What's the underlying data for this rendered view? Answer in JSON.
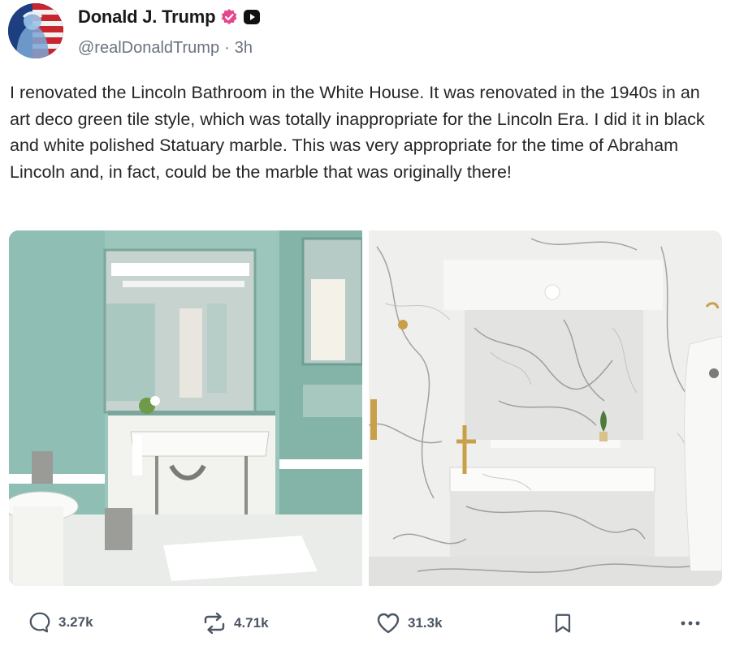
{
  "post": {
    "author_name": "Donald J. Trump",
    "handle": "@realDonaldTrump",
    "separator": "·",
    "time": "3h",
    "text": "I renovated the Lincoln Bathroom in the White House. It was renovated in the 1940s in an art deco green tile style, which was totally inappropriate for the Lincoln Era. I did it in black and white polished Statuary marble. This was very appropriate for the time of Abraham Lincoln and, in fact, could be the marble that was originally there!"
  },
  "media": {
    "images": [
      {
        "subject": "green tile bathroom (before)"
      },
      {
        "subject": "white marble bathroom (after)"
      }
    ]
  },
  "actions": {
    "reply_count": "3.27k",
    "repost_count": "4.71k",
    "like_count": "31.3k"
  },
  "icons": {
    "reply": "reply-icon",
    "repost": "repost-icon",
    "like": "heart-icon",
    "bookmark": "bookmark-icon",
    "more": "more-icon",
    "verified": "verified-badge-icon"
  },
  "colors": {
    "verified_badge": "#e5468d",
    "text": "#262626",
    "muted": "#6b7280",
    "icon": "#4b5563"
  }
}
